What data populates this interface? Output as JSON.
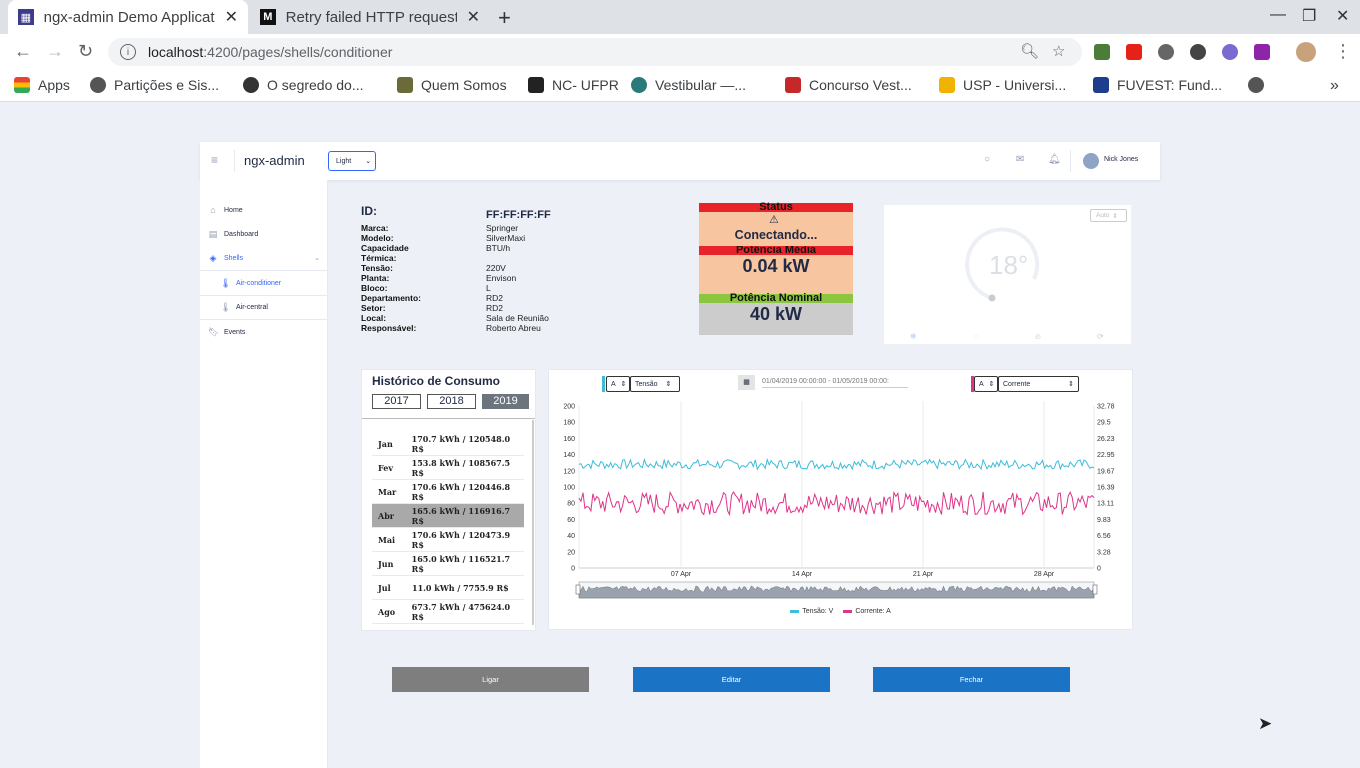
{
  "browser": {
    "tabs": [
      {
        "title": "ngx-admin Demo Applicat",
        "favicon": "ngx-icon"
      },
      {
        "title": "Retry failed HTTP request",
        "favicon": "medium-icon"
      }
    ],
    "url_host": "localhost",
    "url_path": ":4200/pages/shells/conditioner",
    "bookmarks": [
      "Apps",
      "Partições e Sis...",
      "O segredo do...",
      "Quem Somos",
      "NC- UFPR",
      "Vestibular —...",
      "Concurso Vest...",
      "USP - Universi...",
      "FUVEST: Fund..."
    ]
  },
  "header": {
    "logo": "ngx-admin",
    "theme": "Light",
    "user": "Nick Jones"
  },
  "sidebar": {
    "items": [
      {
        "label": "Home",
        "icon": "home-icon"
      },
      {
        "label": "Dashboard",
        "icon": "layout-icon"
      },
      {
        "label": "Shells",
        "icon": "layers-icon"
      },
      {
        "label": "Air-conditioner",
        "icon": "thermometer-icon"
      },
      {
        "label": "Air-central",
        "icon": "thermometer-icon"
      },
      {
        "label": "Events",
        "icon": "bookmark-icon"
      }
    ]
  },
  "device": {
    "id_label": "ID:",
    "id_value": "FF:FF:FF:FF",
    "fields": [
      {
        "label": "Marca:",
        "value": "Springer"
      },
      {
        "label": "Modelo:",
        "value": "SilverMaxi"
      },
      {
        "label": "Capacidade",
        "value": "BTU/h"
      },
      {
        "label": "Térmica:",
        "value": ""
      },
      {
        "label": "Tensão:",
        "value": "220V"
      },
      {
        "label": "Planta:",
        "value": "Envison"
      },
      {
        "label": "Bloco:",
        "value": "L"
      },
      {
        "label": "Departamento:",
        "value": "RD2"
      },
      {
        "label": "Setor:",
        "value": "RD2"
      },
      {
        "label": "Local:",
        "value": "Sala de Reunião"
      },
      {
        "label": "Responsável:",
        "value": "Roberto Abreu"
      }
    ]
  },
  "status": {
    "title": "Status",
    "state": "Conectando...",
    "avg_power_label": "Potência Média",
    "avg_power": "0.04 kW",
    "nominal_label": "Potência Nominal",
    "nominal": "40 kW",
    "colors": {
      "red": "#e8232a",
      "peach": "#f7c5a0",
      "green": "#8cc63f",
      "grey": "#cccccc"
    }
  },
  "thermostat": {
    "mode": "Auto",
    "temperature": "18°",
    "level": 0.45
  },
  "history": {
    "title": "Histórico de Consumo",
    "years": [
      "2017",
      "2018",
      "2019"
    ],
    "selected_year": "2019",
    "rows": [
      {
        "month": "Jan",
        "value": "170.7 kWh / 120548.0 R$"
      },
      {
        "month": "Fev",
        "value": "153.8 kWh / 108567.5 R$"
      },
      {
        "month": "Mar",
        "value": "170.6 kWh / 120446.8 R$"
      },
      {
        "month": "Abr",
        "value": "165.6 kWh / 116916.7 R$",
        "selected": true
      },
      {
        "month": "Mai",
        "value": "170.6 kWh / 120473.9 R$"
      },
      {
        "month": "Jun",
        "value": "165.0 kWh / 116521.7 R$"
      },
      {
        "month": "Jul",
        "value": "11.0 kWh / 7755.9 R$"
      },
      {
        "month": "Ago",
        "value": "673.7 kWh / 475624.0 R$"
      }
    ]
  },
  "chart_controls": {
    "left_axis": "A",
    "left_metric": "Tensão",
    "date_range": "01/04/2019 00:00:00 - 01/05/2019 00:00:",
    "right_axis": "A",
    "right_metric": "Corrente"
  },
  "chart_data": {
    "type": "line",
    "x_ticks": [
      "07 Apr",
      "14 Apr",
      "21 Apr",
      "28 Apr"
    ],
    "y_left_ticks": [
      "200",
      "180",
      "160",
      "140",
      "120",
      "100",
      "80",
      "60",
      "40",
      "20",
      "0"
    ],
    "y_right_ticks": [
      "32.78",
      "29.5",
      "26.23",
      "22.95",
      "19.67",
      "16.39",
      "13.11",
      "9.83",
      "6.56",
      "3.28",
      "0"
    ],
    "ylim_left": [
      0,
      200
    ],
    "ylim_right": [
      0,
      32.78
    ],
    "series": [
      {
        "name": "Tensão: V",
        "color": "#3ebcd8",
        "axis": "left",
        "mean": 128,
        "amplitude": 6
      },
      {
        "name": "Corrente: A",
        "color": "#e0338a",
        "axis": "left",
        "mean": 80,
        "amplitude": 14
      }
    ],
    "grid": true,
    "legend": "bottom"
  },
  "actions": {
    "on": "Ligar",
    "edit": "Editar",
    "close": "Fechar"
  }
}
